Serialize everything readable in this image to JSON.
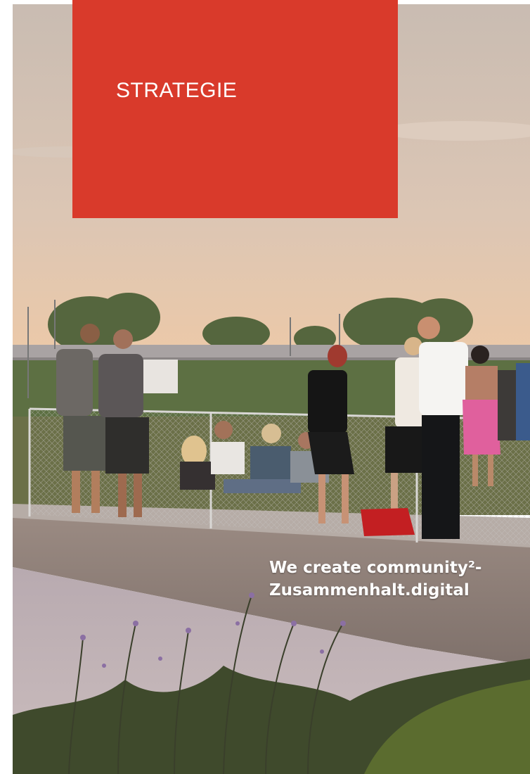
{
  "section": {
    "label": "STRATEGIE"
  },
  "claim": {
    "line1": "We create community²-",
    "line2": "Zusammenhalt.digital"
  },
  "colors": {
    "accent_red": "#d93a2b",
    "sky_top": "#cfc0b3",
    "sky_bottom": "#e9c9ae",
    "bridge": "#8e7f78",
    "water": "#b9aeb4"
  }
}
